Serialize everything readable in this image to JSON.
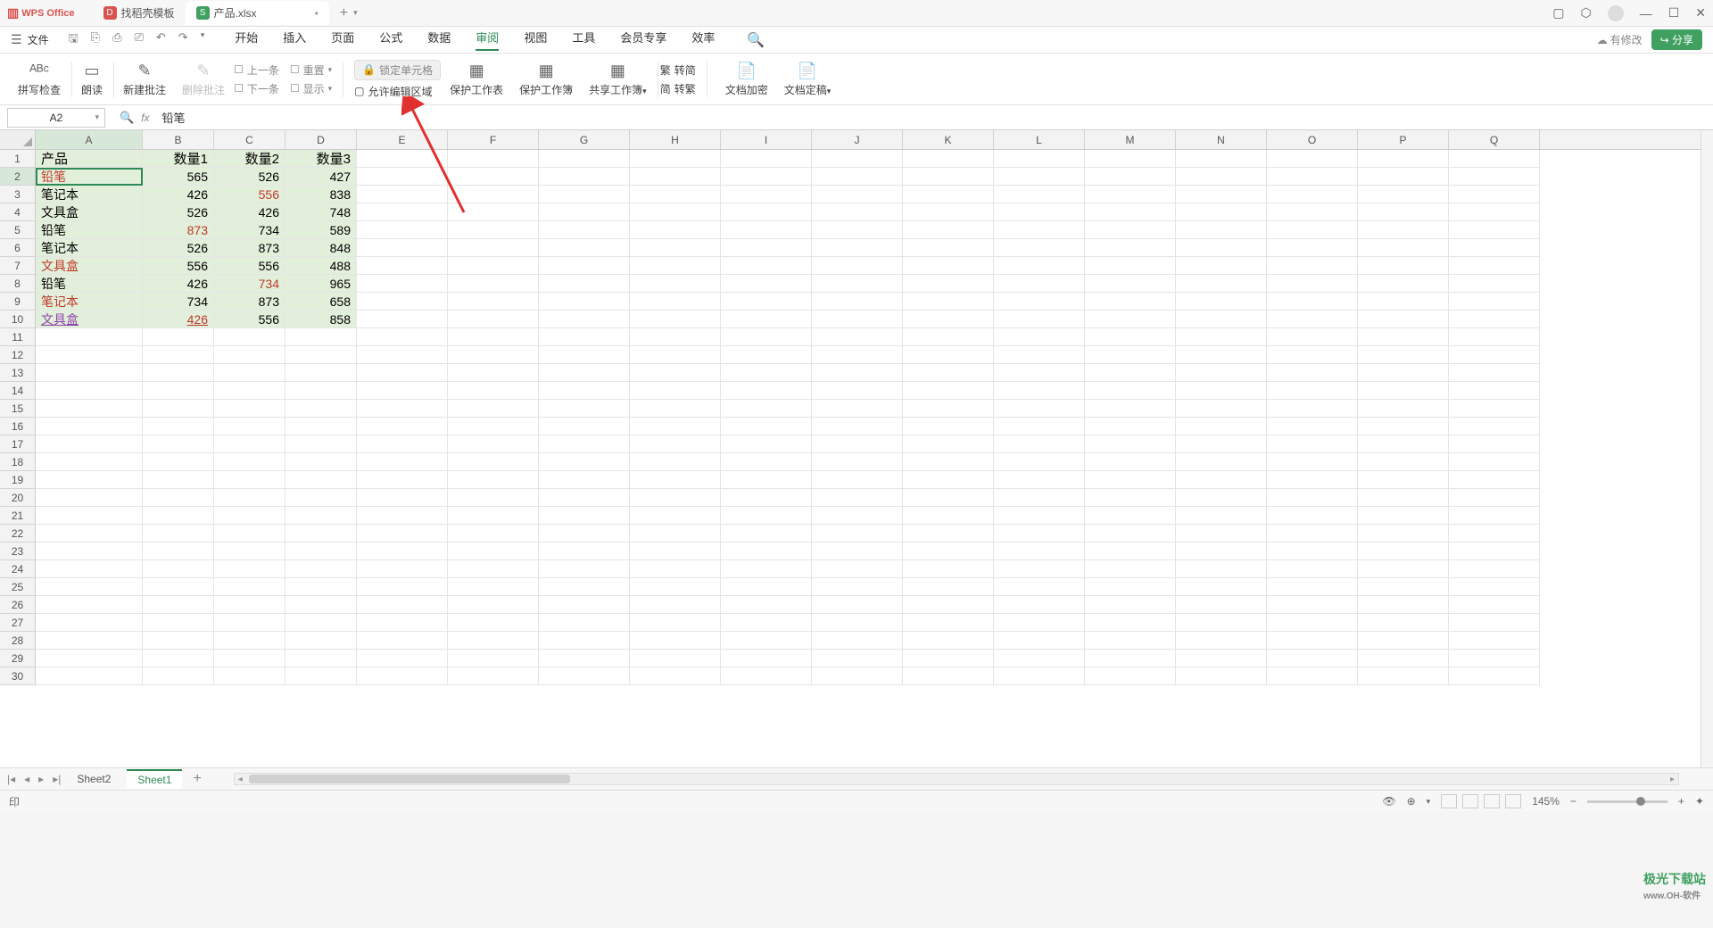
{
  "app": {
    "name": "WPS Office"
  },
  "docTabs": [
    {
      "label": "找稻壳模板",
      "icon": "red"
    },
    {
      "label": "产品.xlsx",
      "icon": "green",
      "active": true
    }
  ],
  "menuFile": "文件",
  "menuTabs": [
    "开始",
    "插入",
    "页面",
    "公式",
    "数据",
    "审阅",
    "视图",
    "工具",
    "会员专享",
    "效率"
  ],
  "activeMenuTab": "审阅",
  "cloudStatus": "有修改",
  "shareLabel": "分享",
  "ribbon": {
    "spellcheck": "拼写检查",
    "read": "朗读",
    "newComment": "新建批注",
    "deleteComment": "删除批注",
    "prev": "上一条",
    "next": "下一条",
    "reset": "重置",
    "show": "显示",
    "lockCell": "锁定单元格",
    "allowEdit": "允许编辑区域",
    "protectSheet": "保护工作表",
    "protectBook": "保护工作簿",
    "shareBook": "共享工作簿",
    "simpTrad1": "转简",
    "simpTrad2": "转繁",
    "simpLabel1": "繁",
    "simpLabel2": "简",
    "encrypt": "文档加密",
    "finalize": "文档定稿"
  },
  "nameBox": "A2",
  "formulaValue": "铅笔",
  "columns": [
    "A",
    "B",
    "C",
    "D",
    "E",
    "F",
    "G",
    "H",
    "I",
    "J",
    "K",
    "L",
    "M",
    "N",
    "O",
    "P",
    "Q"
  ],
  "highlightCol": "A",
  "rowCount": 30,
  "highlightedRow": 2,
  "data": {
    "headers": [
      "产品",
      "数量1",
      "数量2",
      "数量3"
    ],
    "rows": [
      {
        "a": "铅笔",
        "b": "565",
        "c": "526",
        "d": "427",
        "aClass": "red"
      },
      {
        "a": "笔记本",
        "b": "426",
        "c": "556",
        "d": "838",
        "cClass": "red"
      },
      {
        "a": "文具盒",
        "b": "526",
        "c": "426",
        "d": "748"
      },
      {
        "a": "铅笔",
        "b": "873",
        "c": "734",
        "d": "589",
        "bClass": "red"
      },
      {
        "a": "笔记本",
        "b": "526",
        "c": "873",
        "d": "848"
      },
      {
        "a": "文具盒",
        "b": "556",
        "c": "556",
        "d": "488",
        "aClass": "red"
      },
      {
        "a": "铅笔",
        "b": "426",
        "c": "734",
        "d": "965",
        "cClass": "red"
      },
      {
        "a": "笔记本",
        "b": "734",
        "c": "873",
        "d": "658",
        "aClass": "red"
      },
      {
        "a": "文具盒",
        "b": "426",
        "c": "556",
        "d": "858",
        "aClass": "purple",
        "bClass": "redund"
      }
    ]
  },
  "sheets": [
    "Sheet2",
    "Sheet1"
  ],
  "activeSheet": "Sheet1",
  "zoom": "145%",
  "statusIcon": "印",
  "watermark": {
    "main": "极光下载站",
    "sub": "www.OH-软件"
  }
}
